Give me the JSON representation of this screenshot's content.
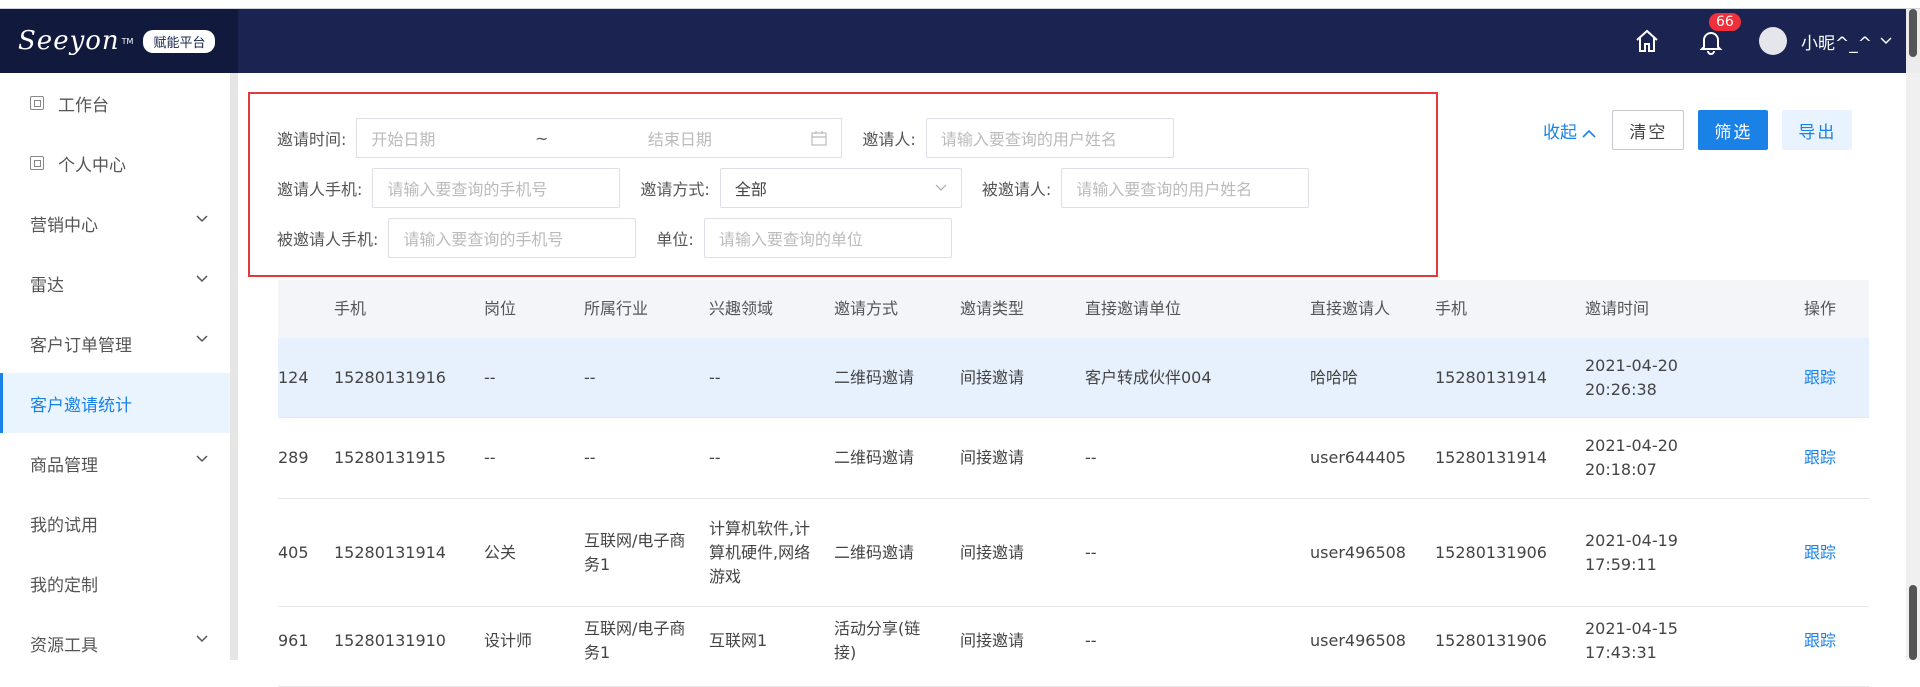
{
  "header": {
    "logo": "Seeyon",
    "logo_tm": "TM",
    "platform_badge": "赋能平台",
    "notification_count": "66",
    "username": "小昵^_^"
  },
  "sidebar": {
    "items": [
      {
        "label": "工作台",
        "icon": "square-icon"
      },
      {
        "label": "个人中心",
        "icon": "square-icon"
      },
      {
        "label": "营销中心",
        "chevron": true
      },
      {
        "label": "雷达",
        "chevron": true
      },
      {
        "label": "客户订单管理",
        "chevron": true
      },
      {
        "label": "客户邀请统计",
        "active": true
      },
      {
        "label": "商品管理",
        "chevron": true
      },
      {
        "label": "我的试用"
      },
      {
        "label": "我的定制"
      },
      {
        "label": "资源工具",
        "chevron": true
      }
    ]
  },
  "filter": {
    "invite_time_label": "邀请时间:",
    "start_placeholder": "开始日期",
    "tilde": "~",
    "end_placeholder": "结束日期",
    "inviter_label": "邀请人:",
    "inviter_placeholder": "请输入要查询的用户姓名",
    "inviter_phone_label": "邀请人手机:",
    "inviter_phone_placeholder": "请输入要查询的手机号",
    "invite_method_label": "邀请方式:",
    "invite_method_value": "全部",
    "invitee_label": "被邀请人:",
    "invitee_placeholder": "请输入要查询的用户姓名",
    "invitee_phone_label": "被邀请人手机:",
    "invitee_phone_placeholder": "请输入要查询的手机号",
    "unit_label": "单位:",
    "unit_placeholder": "请输入要查询的单位"
  },
  "actions": {
    "collapse": "收起",
    "clear": "清空",
    "filter": "筛选",
    "export": "导出"
  },
  "table": {
    "columns": [
      "",
      "手机",
      "岗位",
      "所属行业",
      "兴趣领域",
      "邀请方式",
      "邀请类型",
      "直接邀请单位",
      "直接邀请人",
      "手机",
      "邀请时间",
      "操作"
    ],
    "rows": [
      [
        "124",
        "15280131916",
        "--",
        "--",
        "--",
        "二维码邀请",
        "间接邀请",
        "客户转成伙伴004",
        "哈哈哈",
        "15280131914",
        "2021-04-20 20:26:38",
        "跟踪"
      ],
      [
        "289",
        "15280131915",
        "--",
        "--",
        "--",
        "二维码邀请",
        "间接邀请",
        "--",
        "user644405",
        "15280131914",
        "2021-04-20 20:18:07",
        "跟踪"
      ],
      [
        "405",
        "15280131914",
        "公关",
        "互联网/电子商务1",
        "计算机软件,计算机硬件,网络游戏",
        "二维码邀请",
        "间接邀请",
        "--",
        "user496508",
        "15280131906",
        "2021-04-19 17:59:11",
        "跟踪"
      ],
      [
        "961",
        "15280131910",
        "设计师",
        "互联网/电子商务1",
        "互联网1",
        "活动分享(链接)",
        "间接邀请",
        "--",
        "user496508",
        "15280131906",
        "2021-04-15 17:43:31",
        "跟踪"
      ]
    ]
  }
}
